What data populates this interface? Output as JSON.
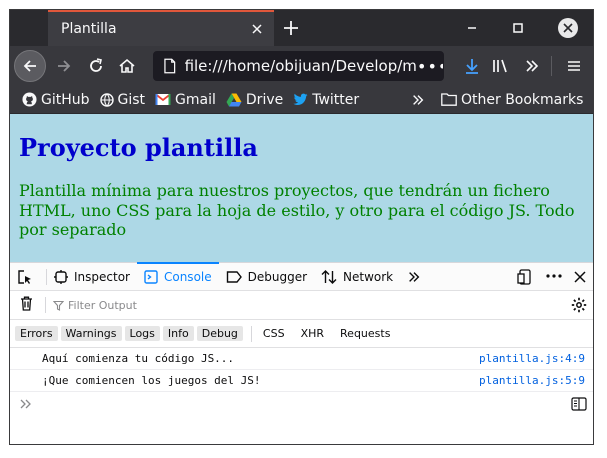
{
  "browser": {
    "tab_title": "Plantilla",
    "url": "file:///home/obijuan/Develop/my",
    "url_more": "•••"
  },
  "bookmarks": [
    {
      "label": "GitHub",
      "icon": "github-icon"
    },
    {
      "label": "Gist",
      "icon": "gist-icon"
    },
    {
      "label": "Gmail",
      "icon": "gmail-icon"
    },
    {
      "label": "Drive",
      "icon": "drive-icon"
    },
    {
      "label": "Twitter",
      "icon": "twitter-icon"
    }
  ],
  "other_bookmarks": "Other Bookmarks",
  "page": {
    "heading": "Proyecto plantilla",
    "paragraph": "Plantilla mínima para nuestros proyectos, que tendrán un fichero HTML, uno CSS para la hoja de estilo, y otro para el código JS. Todo por separado"
  },
  "devtools": {
    "tabs": [
      {
        "label": "Inspector"
      },
      {
        "label": "Console"
      },
      {
        "label": "Debugger"
      },
      {
        "label": "Network"
      }
    ],
    "active_tab": "Console",
    "filter_placeholder": "Filter Output",
    "categories_toggled": [
      "Errors",
      "Warnings",
      "Logs",
      "Info",
      "Debug"
    ],
    "categories_plain": [
      "CSS",
      "XHR",
      "Requests"
    ],
    "logs": [
      {
        "message": "Aquí comienza tu código JS...",
        "source": "plantilla.js:4:9"
      },
      {
        "message": "¡Que comiencen los juegos del JS!",
        "source": "plantilla.js:5:9"
      }
    ]
  },
  "colors": {
    "page_background": "#add8e6",
    "heading": "#0000cc",
    "paragraph": "#008000",
    "active_tab_accent": "#0a84ff",
    "tab_top_accent": "#e1573b",
    "source_link": "#0060df"
  }
}
